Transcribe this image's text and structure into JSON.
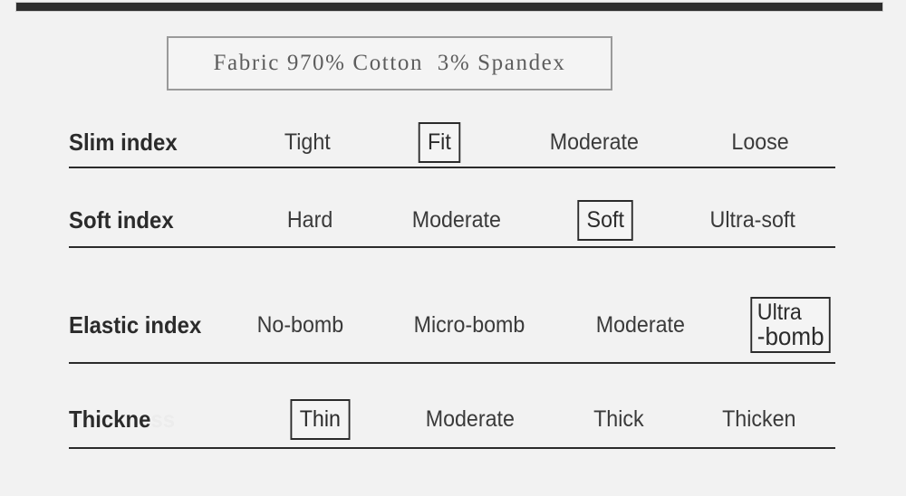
{
  "page": {
    "background_color": "#f2f2f2",
    "text_color": "#2b2b2b",
    "selected_border_color": "#2b2b2b",
    "divider_color": "#2b2b2b",
    "fabric_box_border_color": "#9a9a9a",
    "top_bar_color": "#2e2e2e"
  },
  "top_bar": {
    "label": ""
  },
  "fabric": {
    "text": "Fabric 970% Cotton  3% Spandex"
  },
  "rows": [
    {
      "id": "slim",
      "label": "Slim index",
      "label_ghost": "",
      "options": [
        {
          "text": "Tight",
          "selected": false
        },
        {
          "text": "Fit",
          "selected": true
        },
        {
          "text": "Moderate",
          "selected": false
        },
        {
          "text": "Loose",
          "selected": false
        }
      ]
    },
    {
      "id": "soft",
      "label": "Soft index",
      "label_ghost": "",
      "options": [
        {
          "text": "Hard",
          "selected": false
        },
        {
          "text": "Moderate",
          "selected": false
        },
        {
          "text": "Soft",
          "selected": true
        },
        {
          "text": "Ultra-soft",
          "selected": false
        }
      ]
    },
    {
      "id": "elastic",
      "label": "Elastic index",
      "label_ghost": "",
      "options": [
        {
          "text": "No-bomb",
          "selected": false
        },
        {
          "text": "Micro-bomb",
          "selected": false
        },
        {
          "text": "Moderate",
          "selected": false
        },
        {
          "text": "Ultra-bomb",
          "selected": true,
          "line1": "Ultra",
          "line2": "-bomb"
        }
      ]
    },
    {
      "id": "thickne",
      "label": "Thickne",
      "label_ghost": "ss",
      "options": [
        {
          "text": "Thin",
          "selected": true
        },
        {
          "text": "Moderate",
          "selected": false
        },
        {
          "text": "Thick",
          "selected": false
        },
        {
          "text": "Thicken",
          "selected": false
        }
      ]
    }
  ]
}
